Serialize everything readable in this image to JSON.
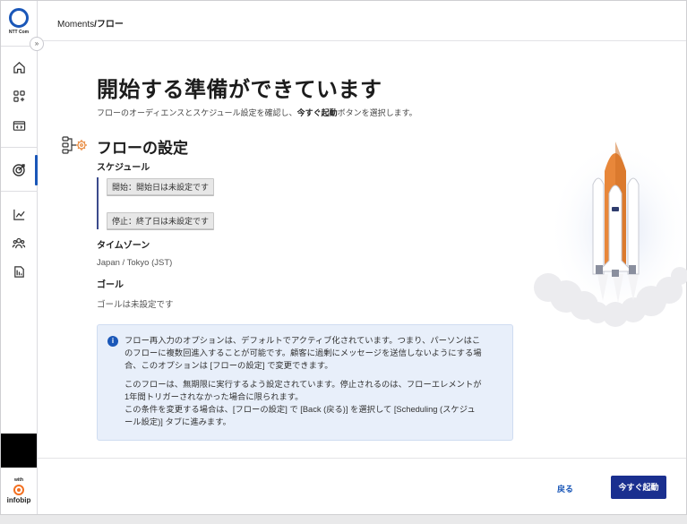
{
  "sidebar": {
    "logo_text": "NTT Com",
    "collapse_glyph": "»",
    "items": [
      {
        "icon": "home-icon"
      },
      {
        "icon": "apps-icon"
      },
      {
        "icon": "code-window-icon"
      },
      {
        "icon": "target-icon",
        "active": true
      },
      {
        "icon": "analytics-icon"
      },
      {
        "icon": "people-icon"
      },
      {
        "icon": "report-icon"
      }
    ],
    "partner": {
      "with": "with",
      "name": "infobip"
    }
  },
  "breadcrumb": {
    "parent": "Moments",
    "separator": "/",
    "current": "フロー"
  },
  "page": {
    "title": "開始する準備ができています",
    "subtitle_before": "フローのオーディエンスとスケジュール設定を確認し、",
    "subtitle_bold": "今すぐ起動",
    "subtitle_after": "ボタンを選択します。"
  },
  "flow_settings": {
    "title": "フローの設定",
    "schedule_label": "スケジュール",
    "start_chip": "開始：開始日は未設定です",
    "stop_chip": "停止：終了日は未設定です",
    "timezone_label": "タイムゾーン",
    "timezone_value": "Japan / Tokyo (JST)",
    "goal_label": "ゴール",
    "goal_value": "ゴールは未設定です"
  },
  "info": {
    "icon_glyph": "i",
    "line1": "フロー再入力のオプションは、デフォルトでアクティブ化されています。つまり、パーソンはこ",
    "line2": "のフローに複数回進入することが可能です。顧客に過剰にメッセージを送信しないようにする場",
    "line3": "合、このオプションは [フローの設定] で変更できます。",
    "line4": "このフローは、無期限に実行するよう設定されています。停止されるのは、フローエレメントが",
    "line5": "1年間トリガーされなかった場合に限られます。",
    "line6": "この条件を変更する場合は、[フローの設定] で [Back (戻る)] を選択して [Scheduling (スケジュ",
    "line7": "ール設定)] タブに進みます。"
  },
  "footer": {
    "back_label": "戻る",
    "launch_label": "今すぐ起動"
  },
  "colors": {
    "accent": "#1a57b8",
    "primary_button": "#1a2f8f",
    "info_bg": "#e8effa",
    "rocket_orange": "#e8873a"
  }
}
